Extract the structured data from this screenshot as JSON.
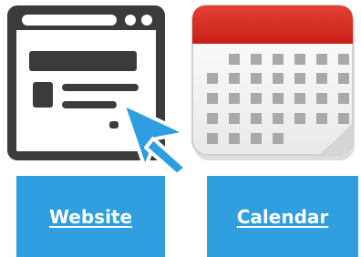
{
  "tiles": {
    "website": {
      "label": "Website",
      "icon": "browser-window-cursor-icon"
    },
    "calendar": {
      "label": "Calendar",
      "icon": "calendar-icon"
    }
  },
  "colors": {
    "tile_bg": "#2f9fdf",
    "tile_text": "#ffffff",
    "icon_dark": "#3b3b3d",
    "cursor_blue": "#2d9fe0",
    "calendar_red": "#d9271d",
    "calendar_grid": "#a9a9a9"
  }
}
